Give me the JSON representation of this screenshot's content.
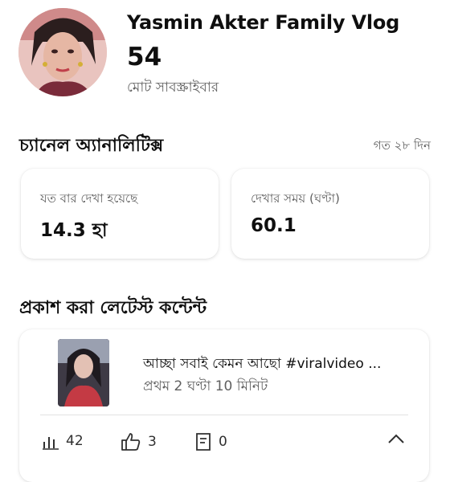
{
  "channel": {
    "name": "Yasmin Akter Family Vlog",
    "subscriber_count": "54",
    "subscriber_label": "মোট সাবস্ক্রাইবার"
  },
  "analytics": {
    "title": "চ্যানেল অ্যানালিটিক্স",
    "range": "গত ২৮ দিন",
    "metrics": [
      {
        "label": "যত বার দেখা হয়েছে",
        "value": "14.3 হা"
      },
      {
        "label": "দেখার সময় (ঘণ্টা)",
        "value": "60.1"
      }
    ]
  },
  "latest": {
    "title": "প্রকাশ করা লেটেস্ট কন্টেন্ট",
    "video": {
      "title": "আচ্ছা সবাই কেমন আছো #viralvideo ...",
      "subtitle": "প্রথম 2 ঘণ্টা 10 মিনিট",
      "views": "42",
      "likes": "3",
      "comments": "0"
    }
  },
  "colors": {
    "text_primary": "#0f0f0f",
    "text_secondary": "#606060",
    "card_shadow": "#d0d0d0"
  },
  "icons": [
    "bar-chart-icon",
    "thumbs-up-icon",
    "comment-icon",
    "chevron-up-icon"
  ]
}
